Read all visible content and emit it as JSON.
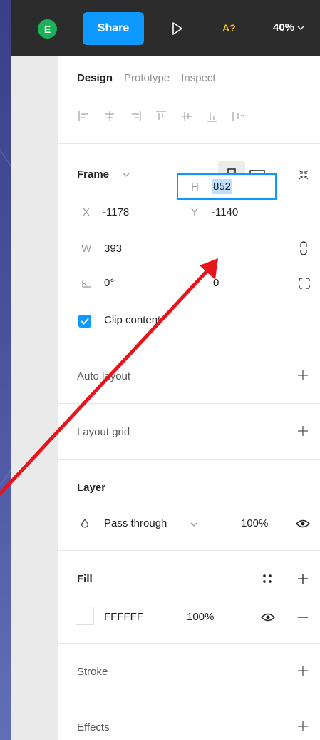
{
  "topbar": {
    "avatar_initial": "E",
    "share_label": "Share",
    "a11y_label": "A?",
    "zoom_label": "40%"
  },
  "tabs": [
    "Design",
    "Prototype",
    "Inspect"
  ],
  "frame": {
    "title": "Frame",
    "x_label": "X",
    "x_value": "-1178",
    "y_label": "Y",
    "y_value": "-1140",
    "w_label": "W",
    "w_value": "393",
    "h_label": "H",
    "h_value": "852",
    "rotation_value": "0°",
    "radius_value": "0",
    "clip_label": "Clip content"
  },
  "sections": {
    "auto_layout": "Auto layout",
    "layout_grid": "Layout grid",
    "layer": "Layer",
    "blend_mode": "Pass through",
    "layer_opacity": "100%",
    "fill": "Fill",
    "fill_hex": "FFFFFF",
    "fill_opacity": "100%",
    "stroke": "Stroke",
    "effects": "Effects"
  },
  "colors": {
    "accent": "#0d99ff",
    "annotation_arrow": "#e8141b",
    "avatar": "#1bb157",
    "a11y": "#f1c21b"
  }
}
